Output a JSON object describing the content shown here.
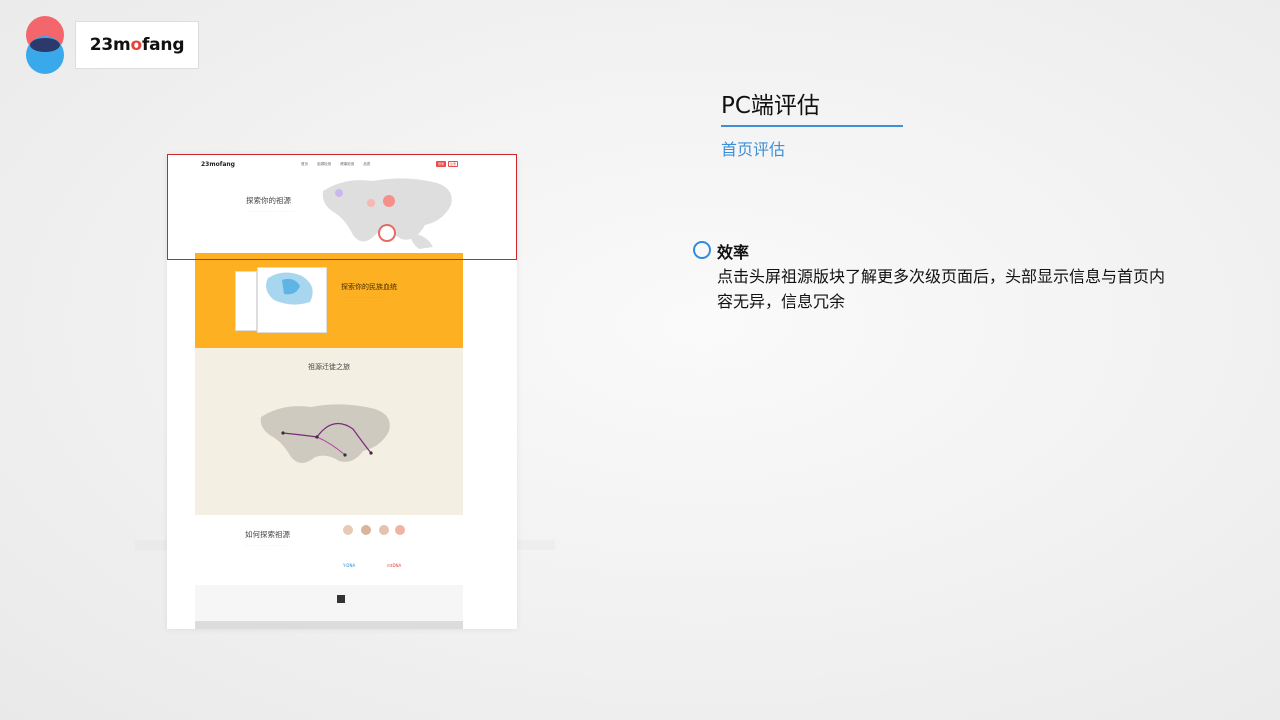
{
  "brand": {
    "name_before": "23m",
    "name_o": "o",
    "name_after": "fang"
  },
  "slide": {
    "title": "PC端评估",
    "subtitle": "首页评估",
    "point_title": "效率",
    "point_body": "点击头屏祖源版块了解更多次级页面后，头部显示信息与首页内容无异，信息冗余"
  },
  "mockup": {
    "logo": "23mofang",
    "nav": "首页 祖源检测 健康检测 品质",
    "login": "登录",
    "register": "注册",
    "hero_title": "探索你的祖源",
    "orange_title": "探索你的民族血统",
    "beige_title": "祖源迁徙之旅",
    "how_title": "如何探索祖源",
    "ydna": "Y-DNA",
    "mtdna": "mtDNA"
  },
  "colors": {
    "accent_blue": "#3d8fd6",
    "orange": "#fdb022",
    "highlight_red": "#c9272b"
  }
}
